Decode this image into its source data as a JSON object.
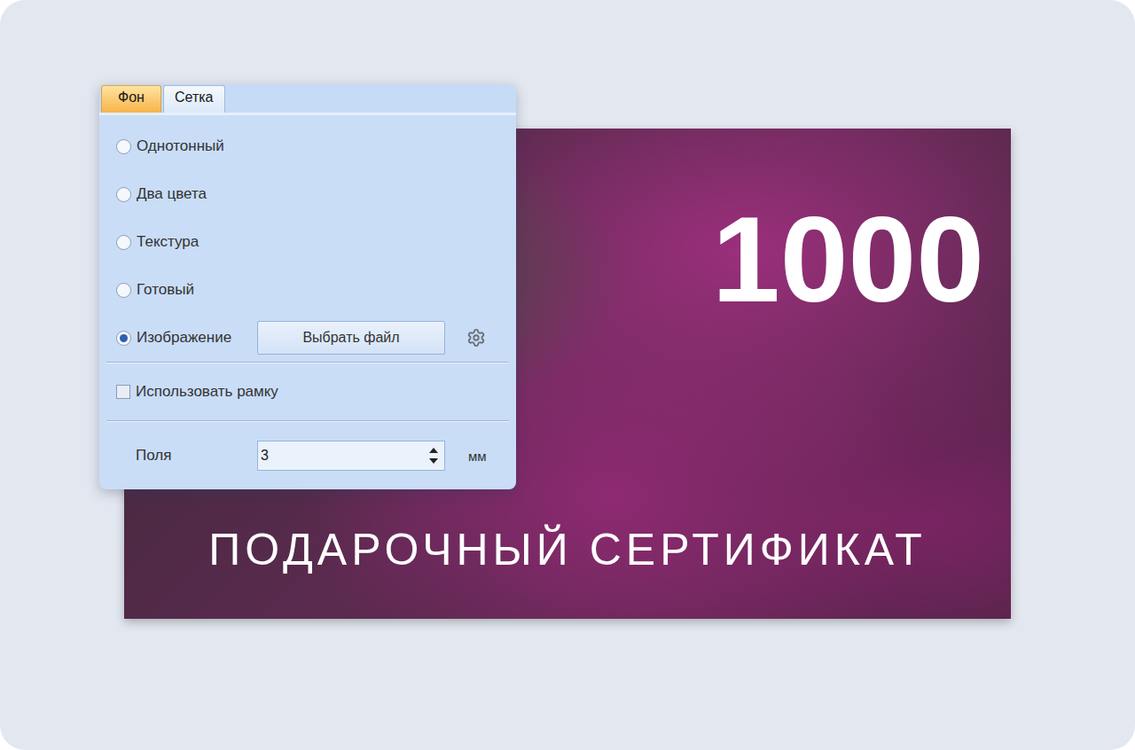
{
  "tabs": [
    {
      "label": "Фон",
      "selected": true
    },
    {
      "label": "Сетка",
      "selected": false
    }
  ],
  "background_options": [
    {
      "label": "Однотонный",
      "selected": false,
      "kind": "plain"
    },
    {
      "label": "Два цвета",
      "selected": false,
      "kind": "plain"
    },
    {
      "label": "Текстура",
      "selected": false,
      "kind": "plain"
    },
    {
      "label": "Готовый",
      "selected": false,
      "kind": "plain"
    },
    {
      "label": "Изображение",
      "selected": true,
      "kind": "file"
    }
  ],
  "file_button": "Выбрать файл",
  "frame_checkbox": {
    "label": "Использовать рамку",
    "checked": false
  },
  "margin_field": {
    "label": "Поля",
    "value": "3",
    "unit": "мм"
  },
  "certificate": {
    "amount": "1000",
    "title": "ПОДАРОЧНЫЙ СЕРТИФИКАТ"
  }
}
